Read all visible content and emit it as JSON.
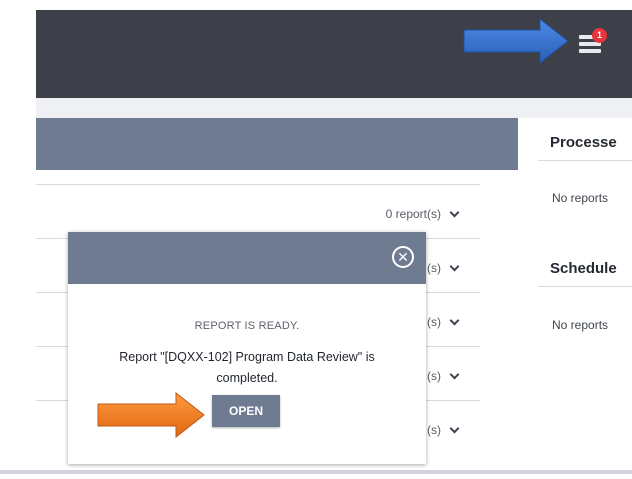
{
  "notifications": {
    "badge_count": "1",
    "icon": "notification-list-icon"
  },
  "report_rows": [
    {
      "count_label": "0 report(s)"
    },
    {
      "count_label": "(s)"
    },
    {
      "count_label": "(s)"
    },
    {
      "count_label": "(s)"
    },
    {
      "count_label": "(s)"
    }
  ],
  "side_sections": [
    {
      "title": "Processe",
      "empty_text": "No reports"
    },
    {
      "title": "Schedule",
      "empty_text": "No reports"
    }
  ],
  "modal": {
    "title": "REPORT IS READY.",
    "message": "Report \"[DQXX-102] Program Data Review\" is completed.",
    "open_label": "OPEN",
    "close_icon": "close-circle-icon"
  },
  "colors": {
    "topbar": "#3d4049",
    "header_slate": "#6f7b91",
    "badge_red": "#e8343b",
    "pointer_blue": "#2f6fd0",
    "pointer_orange": "#f07a22"
  }
}
